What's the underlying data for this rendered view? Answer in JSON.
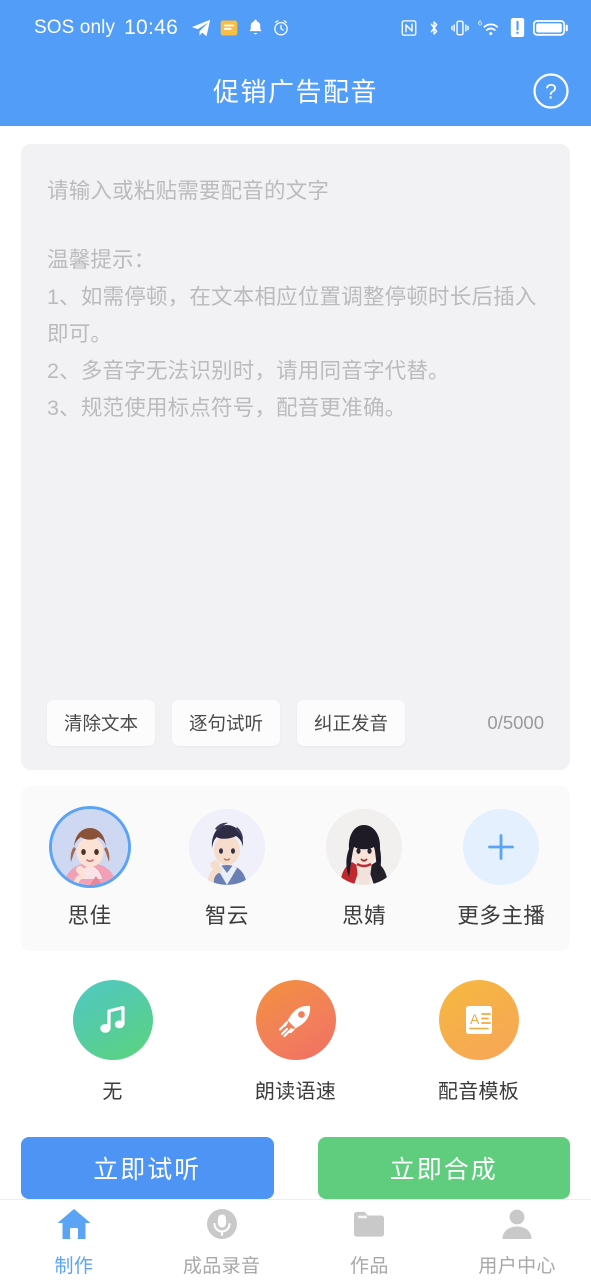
{
  "statusbar": {
    "carrier": "SOS only",
    "time": "10:46",
    "left_icons": [
      "telegram-icon",
      "message-icon",
      "bell-icon",
      "alarm-icon"
    ],
    "right_icons": [
      "nfc-icon",
      "bluetooth-icon",
      "vibrate-icon",
      "wifi6-icon",
      "alert-icon",
      "battery-icon"
    ],
    "background": "#519DF7"
  },
  "header": {
    "title": "促销广告配音",
    "help_icon": "question-circle-icon",
    "background": "#519DF7"
  },
  "editor": {
    "placeholder_line1": "请输入或粘贴需要配音的文字",
    "placeholder_tips_title": "温馨提示：",
    "placeholder_tip1": "1、如需停顿，在文本相应位置调整停顿时长后插入即可。",
    "placeholder_tip2": "2、多音字无法识别时，请用同音字代替。",
    "placeholder_tip3": "3、规范使用标点符号，配音更准确。",
    "value": "",
    "toolbar": {
      "clear_label": "清除文本",
      "sentence_preview_label": "逐句试听",
      "fix_pronunciation_label": "纠正发音"
    },
    "counter": "0/5000",
    "counter_current": 0,
    "counter_max": 5000,
    "background": "#F2F2F4"
  },
  "speakers": {
    "items": [
      {
        "name": "思佳",
        "selected": true,
        "avatar": "avatar-female-brown-hair"
      },
      {
        "name": "智云",
        "selected": false,
        "avatar": "avatar-male-dark-hair"
      },
      {
        "name": "思婧",
        "selected": false,
        "avatar": "avatar-female-black-hair-red"
      },
      {
        "name": "更多主播",
        "selected": false,
        "avatar": "plus-icon"
      }
    ],
    "selected_ring_color": "#5BA4F5"
  },
  "features": [
    {
      "label": "无",
      "icon": "music-note-icon",
      "accent": "#55CBA6"
    },
    {
      "label": "朗读语速",
      "icon": "rocket-icon",
      "accent": "#F2805A"
    },
    {
      "label": "配音模板",
      "icon": "document-text-icon",
      "accent": "#F6AE4B"
    }
  ],
  "actions": {
    "preview_label": "立即试听",
    "preview_color": "#4D94F4",
    "compose_label": "立即合成",
    "compose_color": "#5FCC7E"
  },
  "bottomnav": {
    "active_color": "#5BA4F5",
    "inactive_color": "#A8A8A8",
    "items": [
      {
        "label": "制作",
        "icon": "home-icon",
        "active": true
      },
      {
        "label": "成品录音",
        "icon": "mic-icon",
        "active": false
      },
      {
        "label": "作品",
        "icon": "folder-icon",
        "active": false
      },
      {
        "label": "用户中心",
        "icon": "person-icon",
        "active": false
      }
    ]
  }
}
